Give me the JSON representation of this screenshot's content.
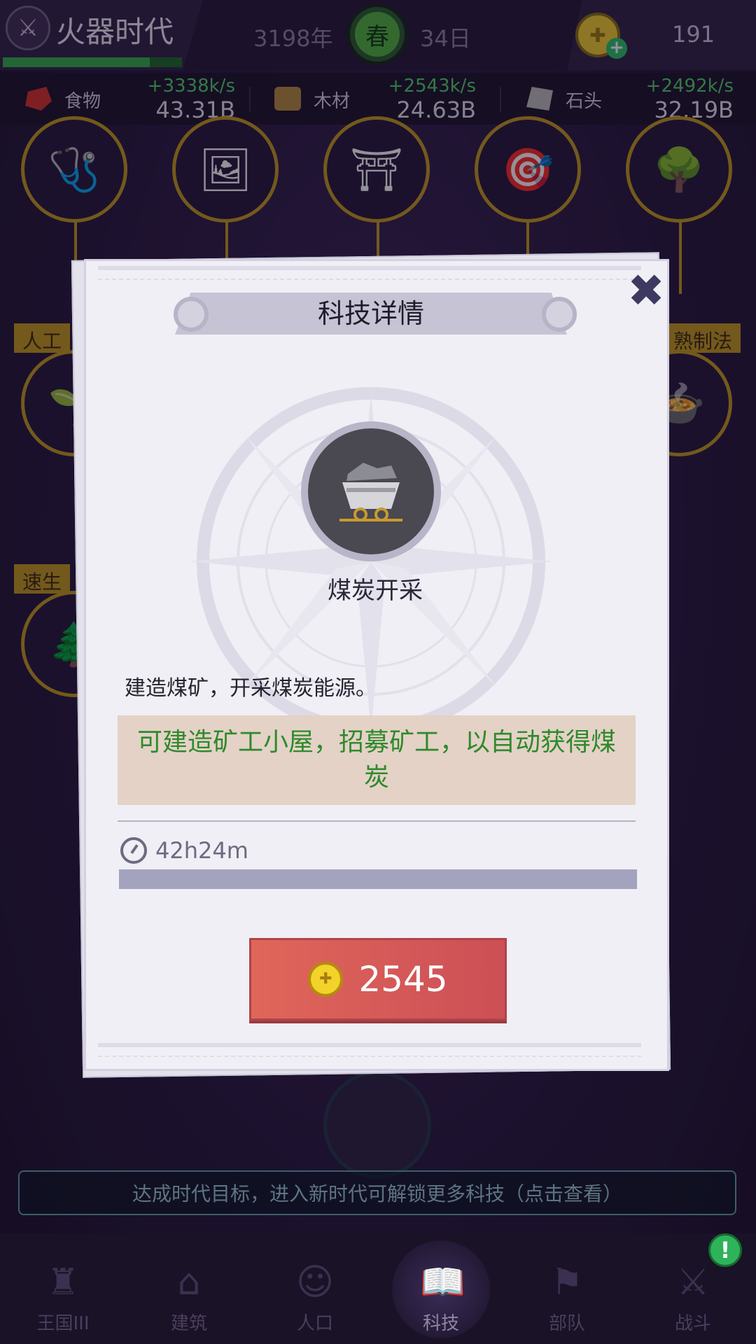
{
  "top": {
    "era_name": "火器时代",
    "era_progress": 0.82,
    "year": "3198年",
    "season": "春",
    "day": "34日",
    "coins": "191"
  },
  "resources": [
    {
      "name": "食物",
      "rate": "+3338k/s",
      "amount": "43.31B",
      "icon": "meat-icon",
      "color": "#d8302a"
    },
    {
      "name": "木材",
      "rate": "+2543k/s",
      "amount": "24.63B",
      "icon": "wood-icon",
      "color": "#b58a3c"
    },
    {
      "name": "石头",
      "rate": "+2492k/s",
      "amount": "32.19B",
      "icon": "stone-icon",
      "color": "#bdbdbd"
    }
  ],
  "background": {
    "ribbon_left_1": "人工",
    "ribbon_right_1": "熟制法",
    "ribbon_left_2": "速生"
  },
  "modal": {
    "title": "科技详情",
    "tech_name": "煤炭开采",
    "tech_icon": "coal-cart-icon",
    "description": "建造煤矿，开采煤炭能源。",
    "effect": "可建造矿工小屋，招募矿工，以自动获得煤炭",
    "duration": "42h24m",
    "progress": 0,
    "cost": "2545"
  },
  "hint": "达成时代目标，进入新时代可解锁更多科技（点击查看）",
  "nav": [
    {
      "label": "王国III",
      "icon": "castle-icon"
    },
    {
      "label": "建筑",
      "icon": "house-icon"
    },
    {
      "label": "人口",
      "icon": "person-icon"
    },
    {
      "label": "科技",
      "icon": "book-icon"
    },
    {
      "label": "部队",
      "icon": "banner-icon"
    },
    {
      "label": "战斗",
      "icon": "crossed-swords-icon"
    }
  ],
  "nav_active": "科技",
  "nav_alert": "!"
}
